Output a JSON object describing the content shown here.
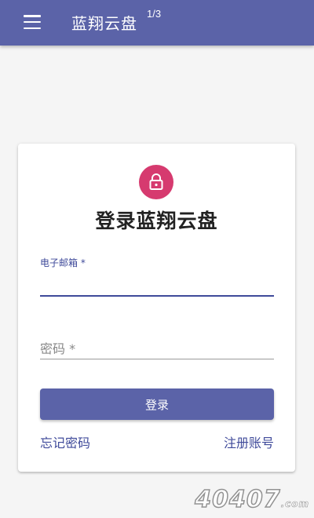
{
  "appbar": {
    "title": "蓝翔云盘",
    "page_indicator": "1/3",
    "menu_icon": "menu-icon"
  },
  "login_card": {
    "avatar_icon": "lock-icon",
    "avatar_color": "#d63a6f",
    "title": "登录蓝翔云盘",
    "email": {
      "label": "电子邮箱 *",
      "value": ""
    },
    "password": {
      "label": "密码 *",
      "value": ""
    },
    "login_button": "登录",
    "forgot_password": "忘记密码",
    "register": "注册账号"
  },
  "colors": {
    "primary": "#5b63a8",
    "label_active": "#3f4a9a",
    "background": "#f5f5f5"
  },
  "watermark": {
    "text": "40407",
    "suffix": ".com"
  }
}
